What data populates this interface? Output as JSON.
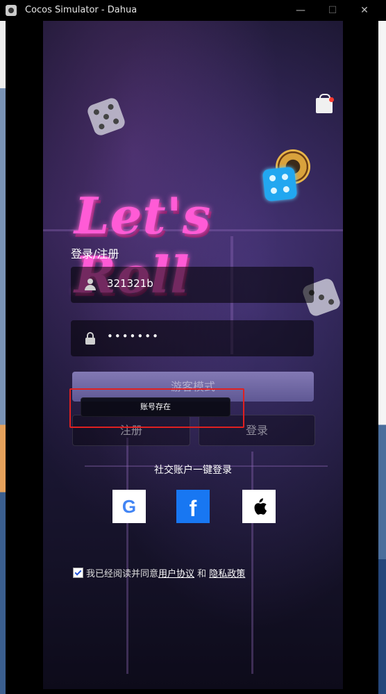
{
  "window": {
    "title": "Cocos Simulator - Dahua",
    "minimize_glyph": "—",
    "maximize_glyph": "☐",
    "close_glyph": "✕"
  },
  "login": {
    "title": "登录/注册",
    "username_value": "321321b",
    "password_mask": "•••••••",
    "guest_button": "游客模式",
    "register_button": "注册",
    "login_button": "登录",
    "toast_message": "账号存在"
  },
  "social": {
    "title": "社交账户一键登录",
    "icons": [
      "google-icon",
      "facebook-icon",
      "apple-icon"
    ],
    "google_glyph": "G",
    "facebook_glyph": "f",
    "apple_glyph": ""
  },
  "agreement": {
    "prefix": "我已经阅读并同意",
    "user_agreement": "用户协议",
    "and": " 和 ",
    "privacy_policy": "隐私政策"
  },
  "logo": {
    "text": "Let's Roll"
  },
  "colors": {
    "accent_pink": "#ff5bd6",
    "guest_button": "#7068a8",
    "facebook_blue": "#1877f2",
    "highlight_red": "#e02020"
  }
}
